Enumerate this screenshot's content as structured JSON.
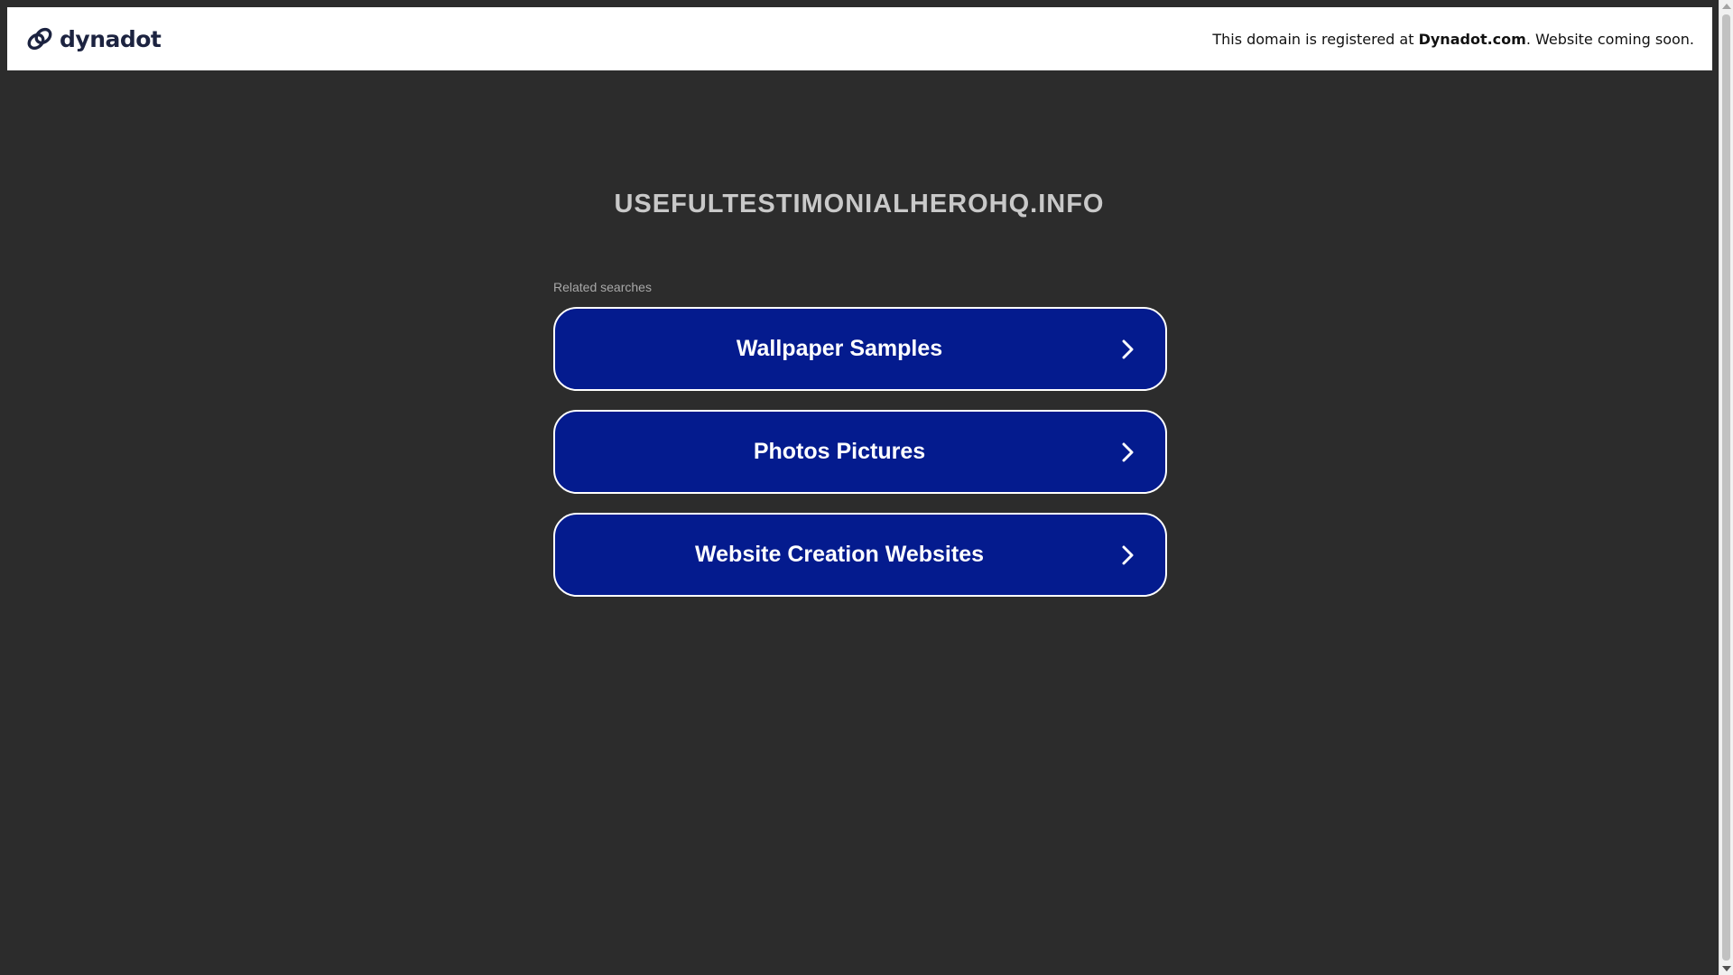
{
  "header": {
    "brand_name": "dynadot",
    "brand_icon": "dynadot-logo-icon",
    "notice_prefix": "This domain is registered at",
    "notice_link": "Dynadot.com",
    "notice_suffix": ". Website coming soon."
  },
  "main": {
    "domain_title": "USEFULTESTIMONIALHEROHQ.INFO",
    "related_label": "Related searches",
    "searches": [
      {
        "label": "Wallpaper Samples",
        "icon": "chevron-right-icon"
      },
      {
        "label": "Photos Pictures",
        "icon": "chevron-right-icon"
      },
      {
        "label": "Website Creation Websites",
        "icon": "chevron-right-icon"
      }
    ]
  },
  "colors": {
    "page_background": "#2c2c2c",
    "header_background": "#ffffff",
    "button_background": "#041b8e",
    "button_border": "#ffffff",
    "title_text": "#c9c9c9"
  }
}
